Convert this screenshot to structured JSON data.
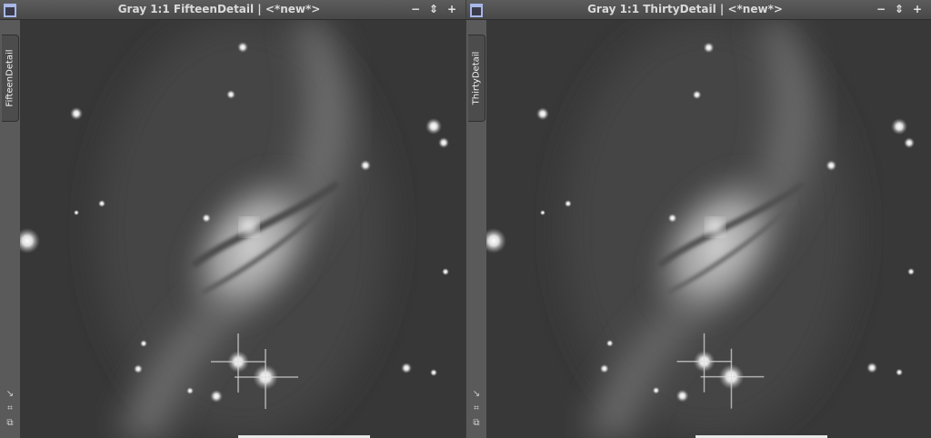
{
  "windows": [
    {
      "title": "Gray 1:1 FifteenDetail | <*new*>",
      "tab_label": "FifteenDetail",
      "buttons": [
        "−",
        "⇕",
        "+"
      ],
      "side_tools": [
        "↘",
        "⌗",
        "⧉"
      ]
    },
    {
      "title": "Gray 1:1 ThirtyDetail | <*new*>",
      "tab_label": "ThirtyDetail",
      "buttons": [
        "−",
        "⇕",
        "+"
      ],
      "side_tools": [
        "↘",
        "⌗",
        "⧉"
      ]
    }
  ],
  "icons": {
    "window_icon": "window-icon",
    "minimize": "minimize-icon",
    "shade": "shade-icon",
    "maximize": "maximize-icon",
    "zoom_tool": "zoom-corner-icon",
    "fit_tool": "fit-view-icon",
    "clone_tool": "clone-view-icon"
  },
  "colors": {
    "titlebar": "#525252",
    "title_text": "#dadada",
    "window_icon": "#a8b7e8",
    "sky_background": "#373737"
  }
}
